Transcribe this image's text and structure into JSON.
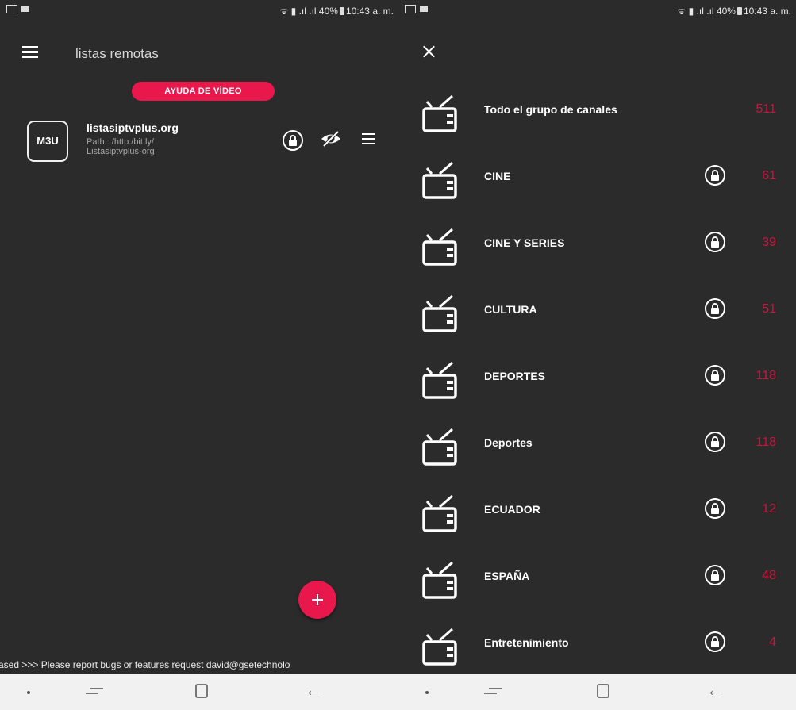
{
  "status_bar": {
    "signal_battery": "40%",
    "time": "10:43 a. m."
  },
  "left_panel": {
    "title": "listas remotas",
    "video_help_label": "AYUDA DE VÍDEO",
    "playlist": {
      "badge": "M3U",
      "name": "listasiptvplus.org",
      "path": "Path : /http:/bit.ly/ Listasiptvplus-org"
    },
    "ticker_text": "ased >>> Please report bugs or features request david@gsetechnolo"
  },
  "right_panel": {
    "channels": [
      {
        "name": "Todo el grupo de canales",
        "count": "511",
        "locked": false
      },
      {
        "name": "CINE",
        "count": "61",
        "locked": true
      },
      {
        "name": "CINE Y SERIES",
        "count": "39",
        "locked": true
      },
      {
        "name": "CULTURA",
        "count": "51",
        "locked": true
      },
      {
        "name": "DEPORTES",
        "count": "118",
        "locked": true
      },
      {
        "name": "Deportes",
        "count": "118",
        "locked": true
      },
      {
        "name": "ECUADOR",
        "count": "12",
        "locked": true
      },
      {
        "name": "ESPAÑA",
        "count": "48",
        "locked": true
      },
      {
        "name": "Entretenimiento",
        "count": "4",
        "locked": true
      }
    ]
  },
  "colors": {
    "background": "#2b2b2c",
    "accent": "#e8174c",
    "count": "#c8163f",
    "navbar": "#f1f1f1"
  },
  "icons": [
    "hamburger-icon",
    "lock-icon",
    "eye-off-icon",
    "menu-icon",
    "add-icon",
    "close-icon",
    "tv-icon",
    "home-icon",
    "back-icon",
    "recents-icon"
  ]
}
